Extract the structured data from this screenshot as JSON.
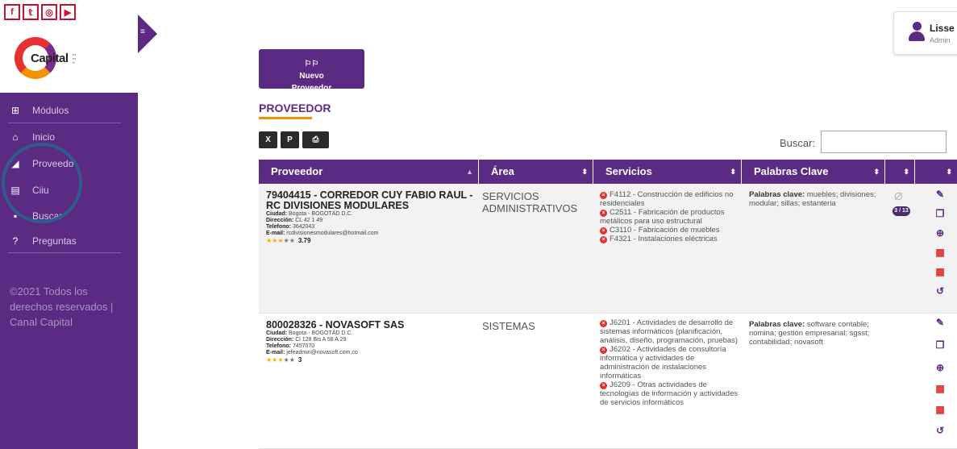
{
  "social": {
    "facebook": "f",
    "twitter": "𝕥",
    "instagram": "◎",
    "youtube": "▶"
  },
  "logo": {
    "word": "Capital"
  },
  "sidebar": {
    "items": [
      {
        "label": "Módulos",
        "icon": "grid-icon"
      },
      {
        "label": "Inicio",
        "icon": "home-icon"
      },
      {
        "label": "Proveedo",
        "icon": "signal-icon"
      },
      {
        "label": "Ciiu",
        "icon": "list-icon"
      },
      {
        "label": "Buscar",
        "icon": "search-icon"
      },
      {
        "label": "Preguntas",
        "icon": "question-icon"
      }
    ],
    "copyright": "©2021 Todos los derechos reservados | Canal Capital"
  },
  "user": {
    "name": "Lisse",
    "role": "Admin"
  },
  "toolbar": {
    "new_button_label": "Nuevo\nProveedor",
    "section_title": "PROVEEDOR",
    "search_label": "Buscar:",
    "search_value": ""
  },
  "table": {
    "headers": [
      "Proveedor",
      "Área",
      "Servicios",
      "Palabras Clave",
      "",
      ""
    ],
    "rows": [
      {
        "title": "79404415 - CORREDOR CUY FABIO RAUL - RC DIVISIONES MODULARES",
        "ciudad": "Bogota - BOGOTÁD D.C.",
        "direccion": "CL 42 1 49",
        "telefono": "3642043",
        "email": "rcdivisionesmodulares@hotmail.com",
        "rating": "3.79",
        "area": "SERVICIOS ADMINISTRATIVOS",
        "services": [
          "F4112 - Construcción de edificios no residenciales",
          "C2511 - Fabricación de productos metálicos para uso estructural",
          "C3110 - Fabricación de muebles",
          "F4321 - Instalaciones eléctricas"
        ],
        "keywords": "muebles; divisiones; modular; sillas; estanteria",
        "attachments": "3 / 13"
      },
      {
        "title": "800028326 - NOVASOFT SAS",
        "ciudad": "Bogota - BOGOTÁD D.C.",
        "direccion": "Cl 128 Bis A 58 A 29",
        "telefono": "7457070",
        "email": "jefeadmin@novasoft.com.co",
        "rating": "3",
        "area": "SISTEMAS",
        "services": [
          "J6201 - Actividades de desarrollo de sistemas informáticos (planificación, análisis, diseño, programación, pruebas)",
          "J6202 - Actividades de consultoría informática y actividades de administración de instalaciones informáticas",
          "J6209 - Otras actividades de tecnologías de información y actividades de servicios informáticos"
        ],
        "keywords": "software contable; nomina; gestión empresarial; sgsst; contabilidad; novasoft",
        "attachments": ""
      }
    ],
    "labels": {
      "ciudad": "Ciudad:",
      "direccion": "Dirección:",
      "telefono": "Telefono:",
      "email": "E-mail:",
      "keywords": "Palabras clave:"
    }
  },
  "colors": {
    "primary": "#5b2a82",
    "accent": "#f39200",
    "danger": "#e53030"
  }
}
